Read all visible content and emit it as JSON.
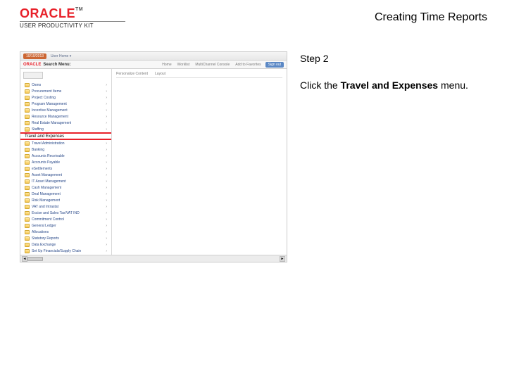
{
  "header": {
    "brand": "ORACLE",
    "tm": "TM",
    "product": "USER PRODUCTIVITY KIT",
    "title": "Creating Time Reports"
  },
  "instruction": {
    "step_label": "Step 2",
    "line_prefix": "Click the ",
    "line_bold": "Travel and Expenses",
    "line_suffix": " menu."
  },
  "screenshot": {
    "date_pill": "10/10/2013",
    "user_home": "User Home ▾",
    "logo": "ORACLE",
    "menu_header": "Search Menu:",
    "nav_tabs": [
      "Home",
      "Worklist",
      "MultiChannel Console",
      "Add to Favorites"
    ],
    "signout": "Sign out",
    "right_tab": "Personalize Content",
    "right_tab2": "Layout",
    "highlight_item": "Travel and Expenses",
    "items_before": [
      "Osmo",
      "Procurement Items",
      "Project Costing",
      "Program Management",
      "Incentive Management",
      "Resource Management",
      "Real Estate Management",
      "Staffing"
    ],
    "items_after": [
      "Travel Administration",
      "Banking",
      "Accounts Receivable",
      "Accounts Payable",
      "eSettlements",
      "Asset Management",
      "IT Asset Management",
      "Cash Management",
      "Deal Management",
      "Risk Management",
      "VAT and Intrastat",
      "Excise and Sales Tax/VAT IND",
      "Commitment Control",
      "General Ledger",
      "Allocations",
      "Statutory Reports",
      "Data Exchange",
      "Set Up Financials/Supply Chain"
    ]
  }
}
